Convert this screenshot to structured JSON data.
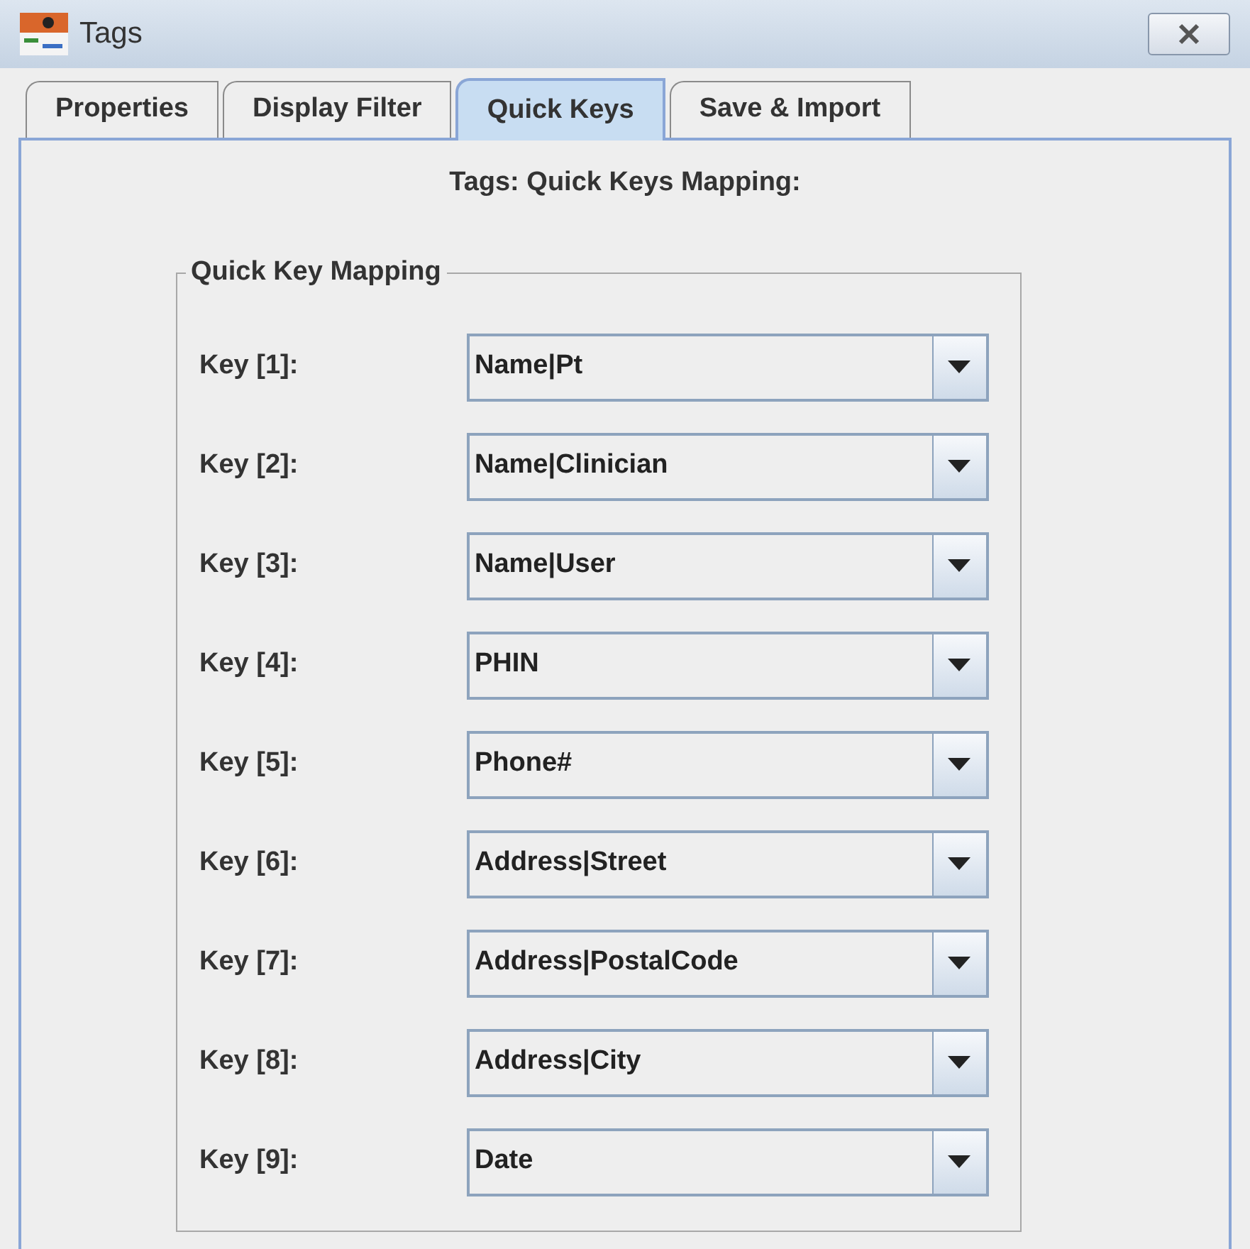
{
  "window": {
    "title": "Tags"
  },
  "tabs": [
    {
      "label": "Properties",
      "selected": false
    },
    {
      "label": "Display Filter",
      "selected": false
    },
    {
      "label": "Quick Keys",
      "selected": true
    },
    {
      "label": "Save & Import",
      "selected": false
    }
  ],
  "heading": "Tags: Quick Keys Mapping:",
  "group": {
    "title": "Quick Key Mapping",
    "rows": [
      {
        "label": "Key [1]:",
        "value": "Name|Pt"
      },
      {
        "label": "Key [2]:",
        "value": "Name|Clinician"
      },
      {
        "label": "Key [3]:",
        "value": "Name|User"
      },
      {
        "label": "Key [4]:",
        "value": "PHIN"
      },
      {
        "label": "Key [5]:",
        "value": "Phone#"
      },
      {
        "label": "Key [6]:",
        "value": "Address|Street"
      },
      {
        "label": "Key [7]:",
        "value": "Address|PostalCode"
      },
      {
        "label": "Key [8]:",
        "value": "Address|City"
      },
      {
        "label": "Key [9]:",
        "value": "Date"
      }
    ]
  }
}
